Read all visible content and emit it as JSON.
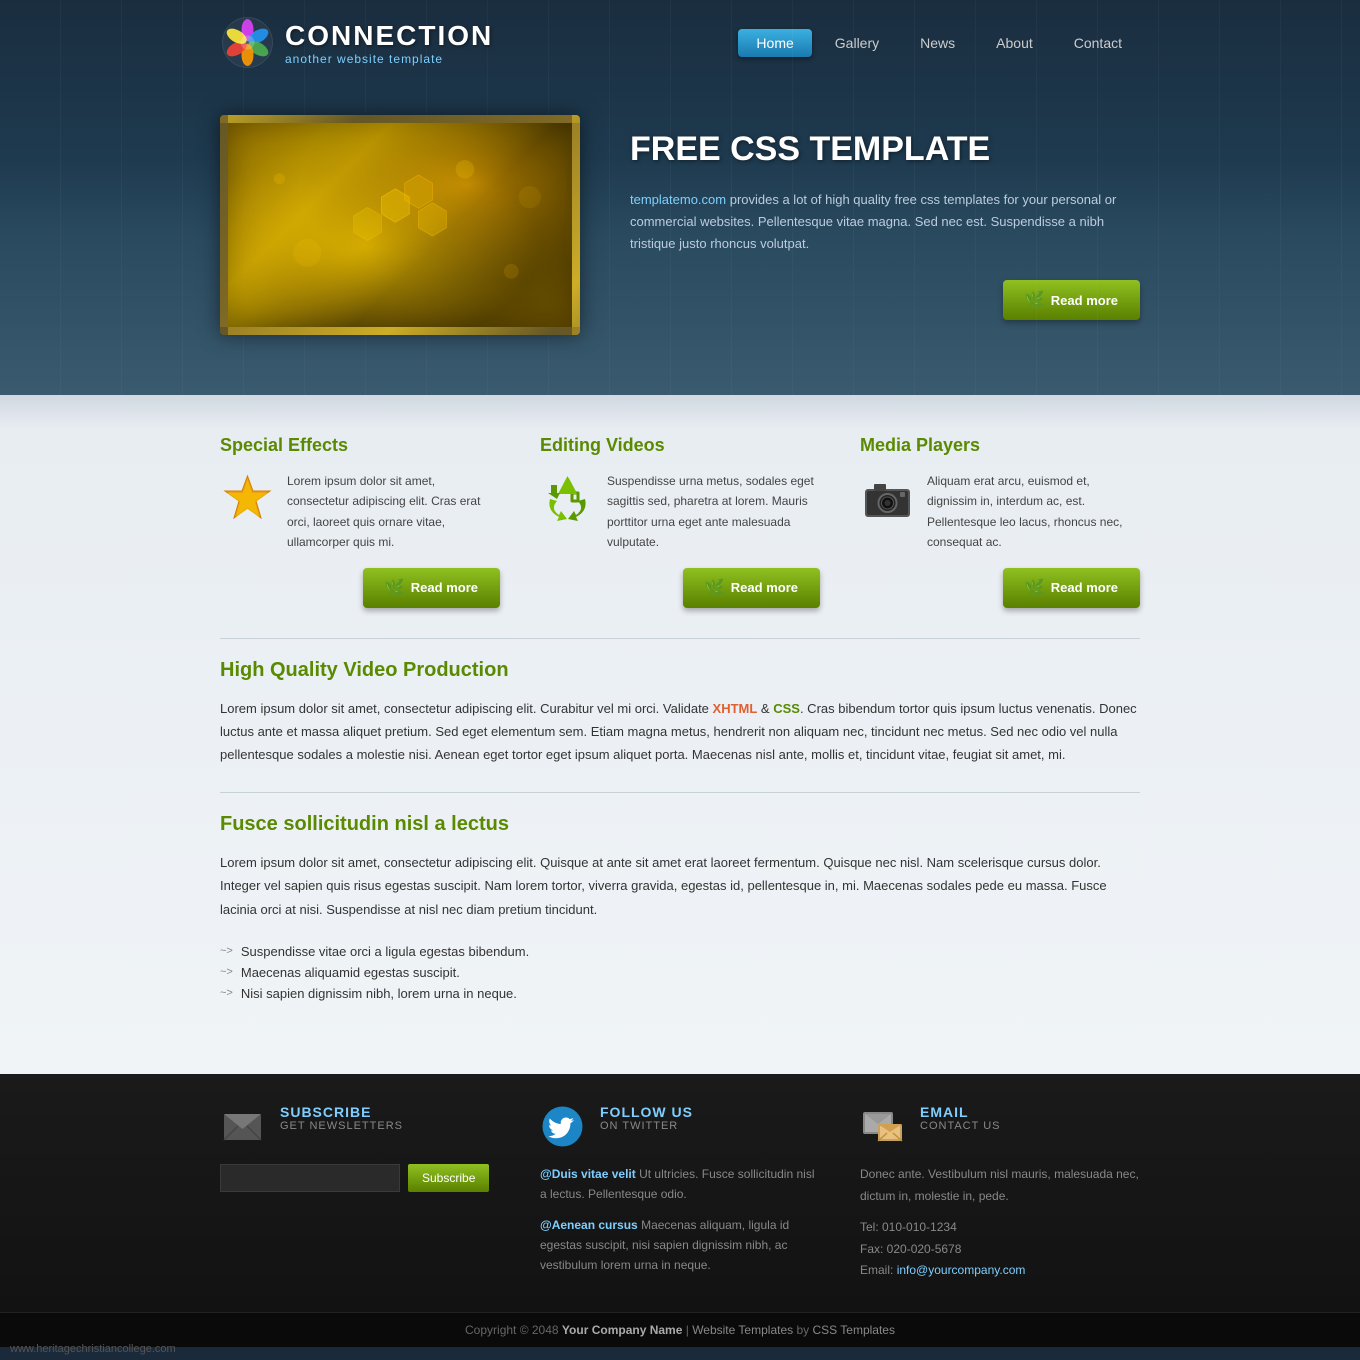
{
  "header": {
    "logo_title": "CONNECTION",
    "logo_subtitle": "another website template",
    "nav": {
      "home": "Home",
      "gallery": "Gallery",
      "news": "News",
      "about": "About",
      "contact": "Contact"
    }
  },
  "hero": {
    "title": "FREE CSS TEMPLATE",
    "body": "provides a lot of high quality free css templates for your personal or commercial websites. Pellentesque vitae magna. Sed nec est. Suspendisse a nibh tristique justo rhoncus volutpat.",
    "link_text": "templatemo.com",
    "read_more": "Read more"
  },
  "features": {
    "col1": {
      "title": "Special Effects",
      "body": "Lorem ipsum dolor sit amet, consectetur adipiscing elit. Cras erat orci, laoreet quis ornare vitae, ullamcorper quis mi.",
      "read_more": "Read more"
    },
    "col2": {
      "title": "Editing Videos",
      "body": "Suspendisse urna metus, sodales eget sagittis sed, pharetra at lorem. Mauris porttitor urna eget ante malesuada vulputate.",
      "read_more": "Read more"
    },
    "col3": {
      "title": "Media Players",
      "body": "Aliquam erat arcu, euismod et, dignissim in, interdum ac, est. Pellentesque leo lacus, rhoncus nec, consequat ac.",
      "read_more": "Read more"
    }
  },
  "video_section": {
    "title": "High Quality Video Production",
    "body": "Lorem ipsum dolor sit amet, consectetur adipiscing elit. Curabitur vel mi orci. Validate XHTML & CSS. Cras bibendum tortor quis ipsum luctus venenatis. Donec luctus ante et massa aliquet pretium. Sed eget elementum sem. Etiam magna metus, hendrerit non aliquam nec, tincidunt nec metus. Sed nec odio vel nulla pellentesque sodales a molestie nisi. Aenean eget tortor eget ipsum aliquet porta. Maecenas nisl ante, mollis et, tincidunt vitae, feugiat sit amet, mi.",
    "link1": "XHTML",
    "link2": "CSS"
  },
  "fusce_section": {
    "title": "Fusce sollicitudin nisl a lectus",
    "body": "Lorem ipsum dolor sit amet, consectetur adipiscing elit. Quisque at ante sit amet erat laoreet fermentum. Quisque nec nisl. Nam scelerisque cursus dolor. Integer vel sapien quis risus egestas suscipit. Nam lorem tortor, viverra gravida, egestas id, pellentesque in, mi. Maecenas sodales pede eu massa. Fusce lacinia orci at nisi. Suspendisse at nisl nec diam pretium tincidunt.",
    "list": [
      "Suspendisse vitae orci a ligula egestas bibendum.",
      "Maecenas aliquamid egestas suscipit.",
      "Nisi sapien dignissim nibh, lorem urna in neque."
    ]
  },
  "footer": {
    "subscribe": {
      "title": "SUBSCRIBE",
      "subtitle": "GET NEWSLETTERS",
      "button": "Subscribe",
      "placeholder": ""
    },
    "twitter": {
      "title": "FOLLOW US",
      "subtitle": "ON TWITTER",
      "tweet1_user": "@Duis vitae velit",
      "tweet1_text": " Ut ultricies. Fusce sollicitudin nisl a lectus. Pellentesque odio.",
      "tweet2_user": "@Aenean cursus",
      "tweet2_text": " Maecenas aliquam, ligula id egestas suscipit, nisi sapien dignissim nibh, ac vestibulum lorem urna in neque."
    },
    "email": {
      "title": "EMAIL",
      "subtitle": "CONTACT US",
      "body": "Donec ante. Vestibulum nisl mauris, malesuada nec, dictum in, molestie in, pede.",
      "tel": "Tel: 010-010-1234",
      "fax": "Fax: 020-020-5678",
      "email_label": "Email:",
      "email_addr": "info@yourcompany.com"
    },
    "copyright": "Copyright © 2048",
    "company": "Your Company Name",
    "sep1": " | ",
    "website_templates": "Website Templates",
    "by": " by ",
    "css_templates": "CSS Templates"
  },
  "watermark": "www.heritagechristiancollege.com"
}
